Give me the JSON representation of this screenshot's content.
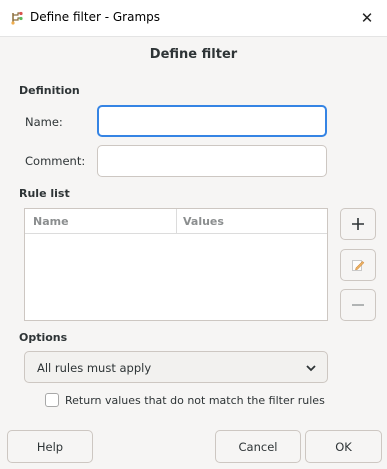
{
  "window": {
    "title": "Define filter - Gramps",
    "close_glyph": "✕"
  },
  "dialog": {
    "title": "Define filter"
  },
  "definition": {
    "section_label": "Definition",
    "name_label": "Name:",
    "name_value": "",
    "comment_label": "Comment:",
    "comment_value": ""
  },
  "rule_list": {
    "section_label": "Rule list",
    "columns": [
      "Name",
      "Values"
    ],
    "rows": [],
    "buttons": {
      "add_icon": "plus-icon",
      "edit_icon": "edit-icon",
      "remove_icon": "minus-icon"
    }
  },
  "options": {
    "section_label": "Options",
    "selected": "All rules must apply",
    "invert_label": "Return values that do not match the filter rules",
    "invert_checked": false
  },
  "footer": {
    "help": "Help",
    "cancel": "Cancel",
    "ok": "OK"
  },
  "colors": {
    "accent": "#3584e4",
    "background": "#f6f5f4"
  }
}
